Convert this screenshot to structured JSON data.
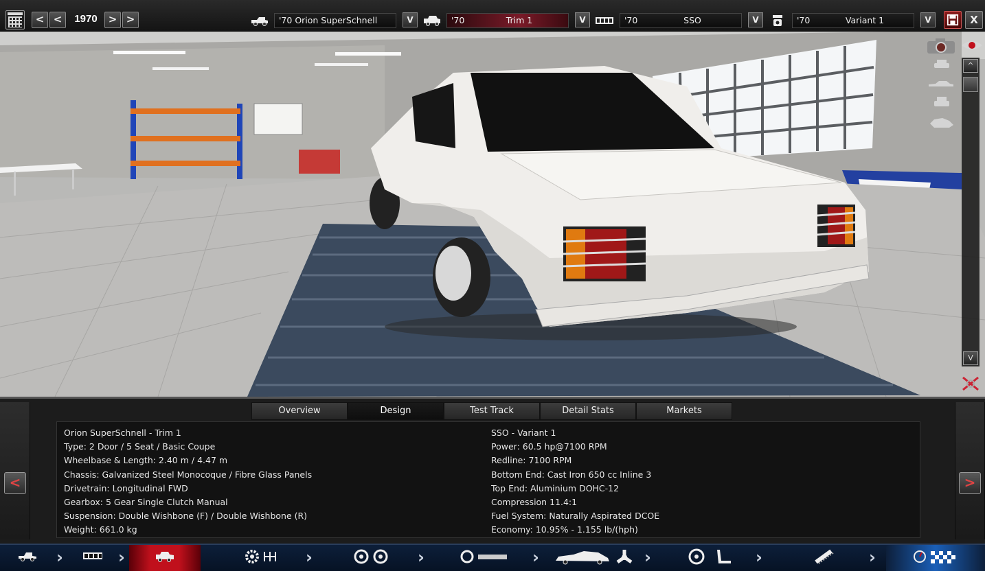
{
  "topbar": {
    "year": "1970",
    "prev_fast": "<",
    "prev": "<",
    "next": ">",
    "next_fast": ">",
    "model": {
      "value": "'70 Orion SuperSchnell",
      "dropdown": "V"
    },
    "trim": {
      "year": "'70",
      "name": "Trim 1",
      "dropdown": "V"
    },
    "engine": {
      "year": "'70",
      "name": "SSO",
      "dropdown": "V"
    },
    "variant": {
      "year": "'70",
      "name": "Variant 1",
      "dropdown": "V"
    },
    "close": "X"
  },
  "viewport": {
    "scroll_up": "^",
    "scroll_down": "V"
  },
  "tabs": [
    "Overview",
    "Design",
    "Test Track",
    "Detail Stats",
    "Markets"
  ],
  "active_tab": "Design",
  "nav": {
    "prev": "<",
    "next": ">"
  },
  "stats": {
    "left": [
      "Orion SuperSchnell - Trim 1",
      "Type: 2 Door / 5 Seat / Basic Coupe",
      "Wheelbase & Length: 2.40 m / 4.47 m",
      "Chassis: Galvanized Steel Monocoque / Fibre Glass Panels",
      "Drivetrain: Longitudinal FWD",
      "Gearbox: 5 Gear Single Clutch Manual",
      "Suspension: Double Wishbone (F) / Double Wishbone (R)",
      "Weight: 661.0 kg"
    ],
    "right": [
      "SSO - Variant 1",
      "Power: 60.5 hp@7100 RPM",
      "Redline: 7100 RPM",
      "Bottom End: Cast Iron 650 cc Inline 3",
      "Top End: Aluminium DOHC-12",
      "Compression 11.4:1",
      "Fuel System: Naturally Aspirated DCOE",
      "Economy: 10.95% - 1.155 lb/(hph)"
    ]
  },
  "bottom_nav": [
    {
      "icon": "car-model-icon",
      "active": false
    },
    {
      "icon": "engine-block-icon",
      "active": false
    },
    {
      "icon": "trim-car-icon",
      "active": true
    },
    {
      "icon": "gear-transmission-icon",
      "active": false
    },
    {
      "icon": "wheels-brakes-icon",
      "active": false
    },
    {
      "icon": "body-aero-icon",
      "active": false
    },
    {
      "icon": "interior-seat-icon",
      "active": false
    },
    {
      "icon": "suspension-icon",
      "active": false
    },
    {
      "icon": "finish-flag-icon",
      "active": false
    }
  ],
  "colors": {
    "accent_red": "#c0101c",
    "bar_blue": "#0d1f3a"
  }
}
